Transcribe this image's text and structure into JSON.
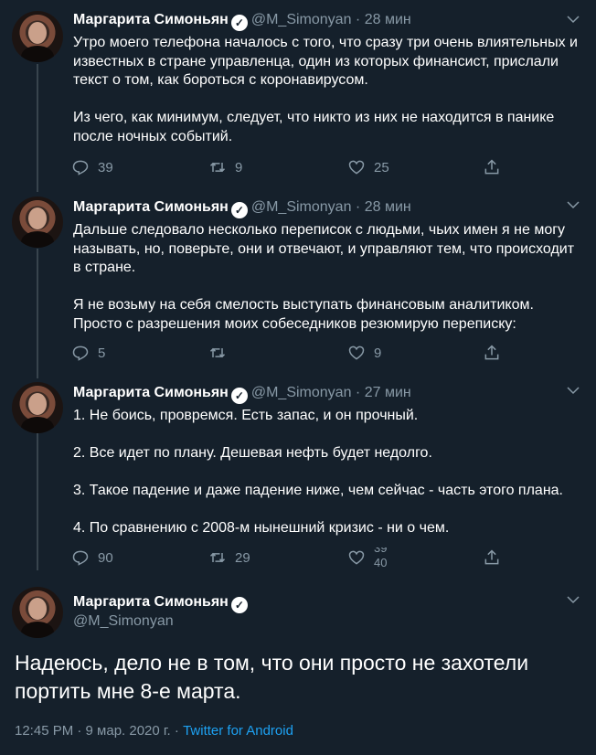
{
  "author": {
    "name": "Маргарита Симоньян",
    "handle": "@M_Simonyan"
  },
  "tweets": [
    {
      "time": "28 мин",
      "separator": "·",
      "paragraphs": [
        "Утро моего телефона началось с того, что сразу три очень влиятельных и известных в стране управленца, один из которых финансист, прислали текст о том, как бороться с коронавирусом.",
        "Из чего, как минимум, следует, что никто из них не находится в панике после ночных событий."
      ],
      "replies": "39",
      "retweets": "9",
      "likes": "25"
    },
    {
      "time": "28 мин",
      "separator": "·",
      "paragraphs": [
        "Дальше следовало несколько переписок с людьми, чьих имен я не могу называть, но, поверьте, они и отвечают, и управляют тем, что происходит в стране.",
        "Я не возьму на себя смелость выступать финансовым аналитиком. Просто с разрешения моих собеседников резюмирую переписку:"
      ],
      "replies": "5",
      "retweets": "",
      "likes": "9"
    },
    {
      "time": "27 мин",
      "separator": "·",
      "paragraphs": [
        "1. Не боись, провремся. Есть запас, и он прочный.",
        "2. Все идет по плану. Дешевая нефть будет недолго.",
        "3. Такое падение и даже падение ниже, чем сейчас - часть этого плана.",
        "4. По сравнению с 2008-м нынешний кризис - ни о чем."
      ],
      "replies": "90",
      "retweets": "29",
      "likes_rolling_top": "39",
      "likes_rolling_bottom": "40"
    }
  ],
  "main_tweet": {
    "text": "Надеюсь, дело не в том, что они просто не захотели портить мне 8-е марта.",
    "timestamp": "12:45 PM · 9 мар. 2020 г. ·",
    "source": "Twitter for Android"
  },
  "icons": {
    "reply": "reply-icon",
    "retweet": "retweet-icon",
    "like": "heart-icon",
    "share": "share-icon",
    "more": "chevron-down-icon",
    "verified": "verified-badge-icon"
  },
  "colors": {
    "background": "#15202b",
    "secondary_text": "#8899a6",
    "link": "#1da1f2",
    "thread_line": "#38444d"
  }
}
